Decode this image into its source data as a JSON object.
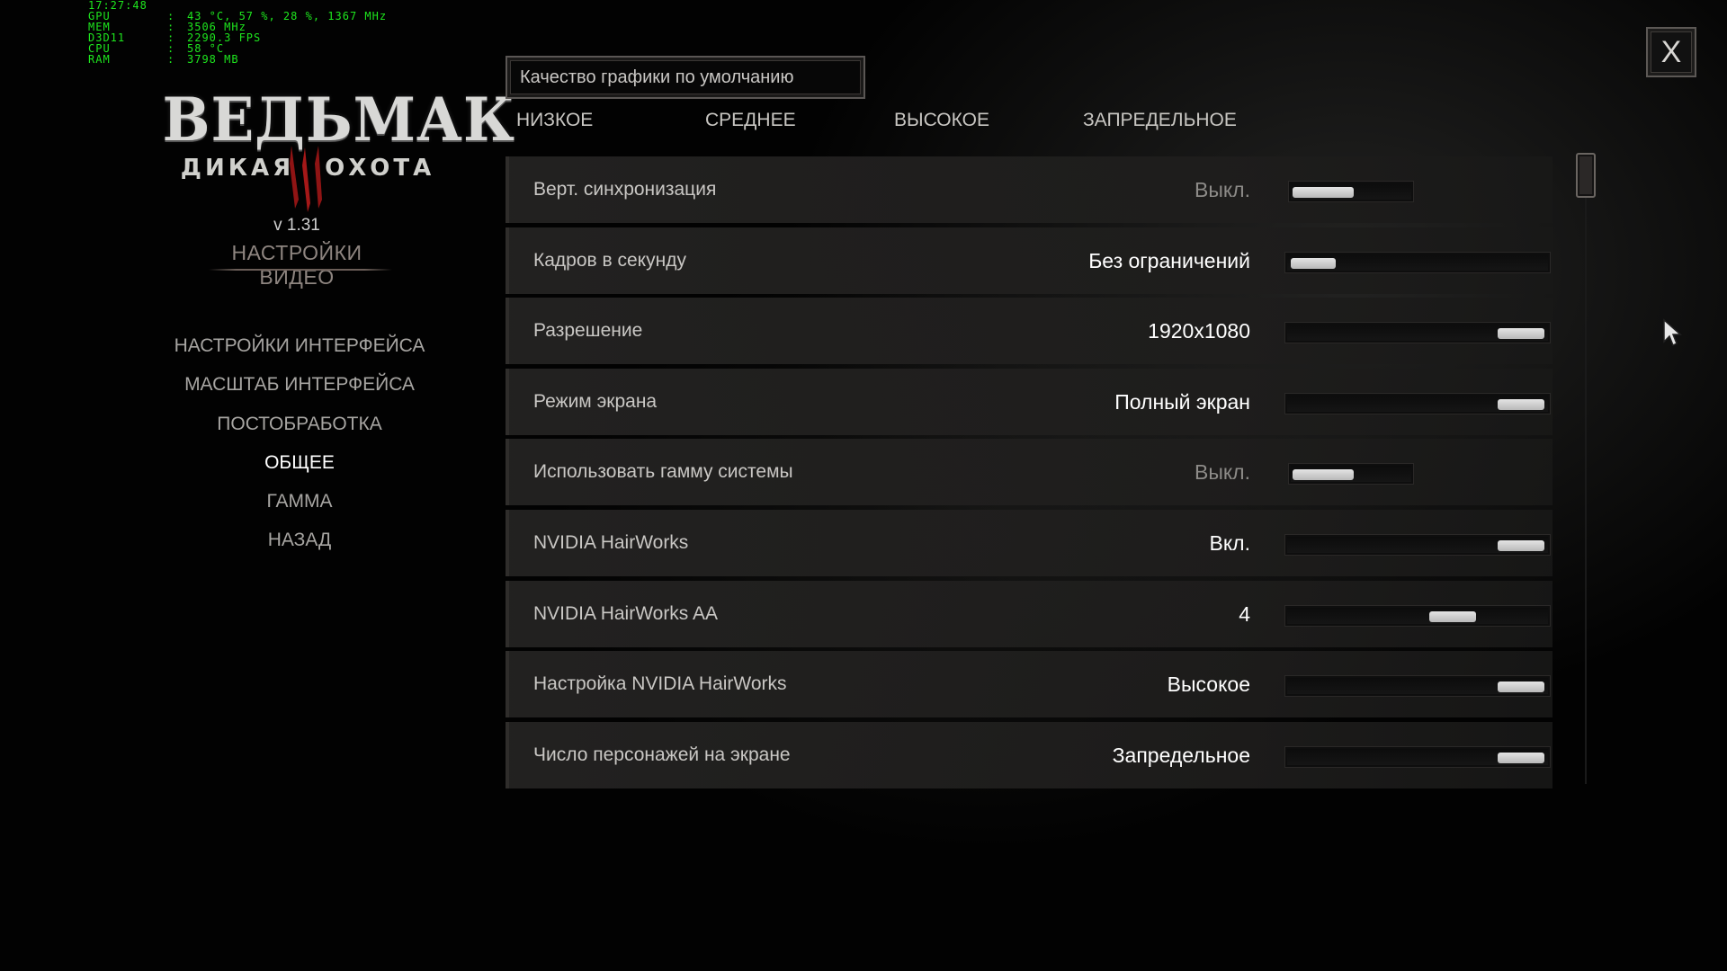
{
  "hud": [
    {
      "key": "",
      "value": "17:27:48"
    },
    {
      "key": "GPU",
      "value": "43 °C, 57 %, 28 %, 1367 MHz"
    },
    {
      "key": "MEM",
      "value": "3506 MHz"
    },
    {
      "key": "D3D11",
      "value": "2290.3 FPS"
    },
    {
      "key": "CPU",
      "value": "58 °C"
    },
    {
      "key": "RAM",
      "value": "3798 MB"
    }
  ],
  "logo": {
    "title": "ВЕДЬМАК",
    "subtitle_left": "ДИКАЯ",
    "subtitle_right": "ОХОТА",
    "mark": "®"
  },
  "version": "v 1.31",
  "section_title": "НАСТРОЙКИ ВИДЕО",
  "menu": [
    {
      "label": "НАСТРОЙКИ ИНТЕРФЕЙСА",
      "active": false
    },
    {
      "label": "МАСШТАБ ИНТЕРФЕЙСА",
      "active": false
    },
    {
      "label": "ПОСТОБРАБОТКА",
      "active": false
    },
    {
      "label": "ОБЩЕЕ",
      "active": true
    },
    {
      "label": "ГАММА",
      "active": false
    },
    {
      "label": "НАЗАД",
      "active": false
    }
  ],
  "preset": {
    "label": "Качество графики по умолчанию",
    "tabs": [
      "НИЗКОЕ",
      "СРЕДНЕЕ",
      "ВЫСОКОЕ",
      "ЗАПРЕДЕЛЬНОЕ"
    ]
  },
  "settings": [
    {
      "label": "Верт. синхронизация",
      "value": "Выкл.",
      "dim": true,
      "slider": "short",
      "level": 0.0
    },
    {
      "label": "Кадров в секунду",
      "value": "Без ограничений",
      "dim": false,
      "slider": "long",
      "level": 0.0
    },
    {
      "label": "Разрешение",
      "value": "1920x1080",
      "dim": false,
      "slider": "long",
      "level": 1.0
    },
    {
      "label": "Режим экрана",
      "value": "Полный экран",
      "dim": false,
      "slider": "long",
      "level": 1.0
    },
    {
      "label": "Использовать гамму системы",
      "value": "Выкл.",
      "dim": true,
      "slider": "short",
      "level": 0.0
    },
    {
      "label": "NVIDIA HairWorks",
      "value": "Вкл.",
      "dim": false,
      "slider": "long",
      "level": 1.0
    },
    {
      "label": "NVIDIA HairWorks AA",
      "value": "4",
      "dim": false,
      "slider": "long",
      "level": 0.67
    },
    {
      "label": "Настройка NVIDIA HairWorks",
      "value": "Высокое",
      "dim": false,
      "slider": "long",
      "level": 1.0
    },
    {
      "label": "Число персонажей на экране",
      "value": "Запредельное",
      "dim": false,
      "slider": "long",
      "level": 1.0
    }
  ],
  "close_label": "X",
  "colors": {
    "hud": "#1ee61e",
    "active_menu": "#ffffff",
    "inactive_menu": "#a7a5a2",
    "section_title": "#8e8580"
  }
}
